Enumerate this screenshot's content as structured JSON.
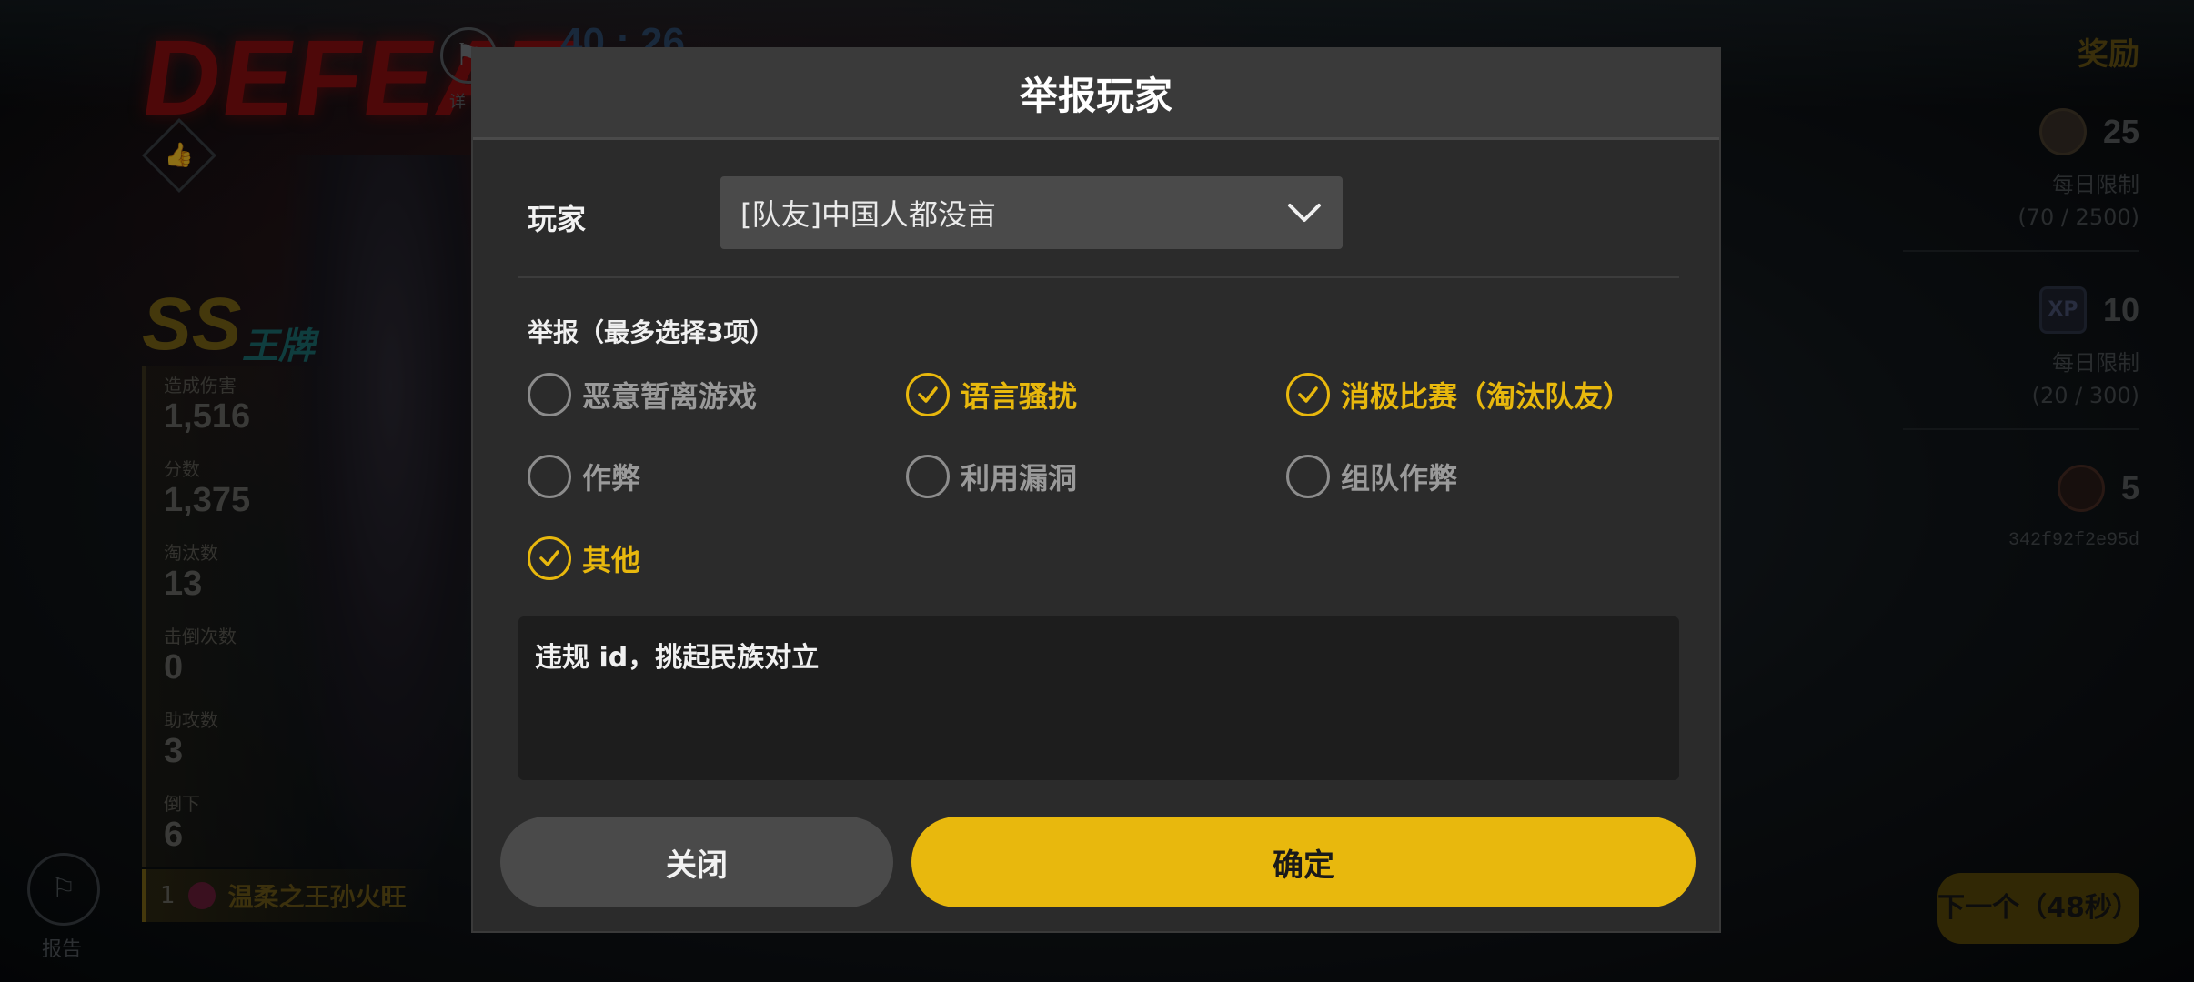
{
  "background": {
    "result_banner": "DEFEAT",
    "detail_label": "详",
    "score_peek": "40 : 26",
    "rank": "SS",
    "ace_label": "王牌",
    "stats": [
      {
        "label": "造成伤害",
        "value": "1,516"
      },
      {
        "label": "分数",
        "value": "1,375"
      },
      {
        "label": "淘汰数",
        "value": "13"
      },
      {
        "label": "击倒次数",
        "value": "0"
      },
      {
        "label": "助攻数",
        "value": "3"
      },
      {
        "label": "倒下",
        "value": "6"
      }
    ],
    "player_strip": {
      "index": "1",
      "name": "温柔之王孙火旺"
    },
    "report_label": "报告",
    "rewards": {
      "title": "奖励",
      "items": [
        {
          "icon": "coin-icon",
          "amount": "25",
          "limit_label": "每日限制",
          "limit_value": "(70 / 2500)"
        },
        {
          "icon": "xp-icon",
          "amount": "10",
          "limit_label": "每日限制",
          "limit_value": "(20 / 300)"
        },
        {
          "icon": "shield-badge-icon",
          "amount": "5",
          "hash": "342f92f2e95d"
        }
      ]
    },
    "next_button": "下一个（48秒）"
  },
  "dialog": {
    "title": "举报玩家",
    "player_label": "玩家",
    "player_selected": "[队友]中国人都没亩",
    "reason_title": "举报（最多选择3项）",
    "options": [
      {
        "label": "恶意暂离游戏",
        "checked": false
      },
      {
        "label": "语言骚扰",
        "checked": true
      },
      {
        "label": "消极比赛（淘汰队友）",
        "checked": true
      },
      {
        "label": "作弊",
        "checked": false
      },
      {
        "label": "利用漏洞",
        "checked": false
      },
      {
        "label": "组队作弊",
        "checked": false
      },
      {
        "label": "其他",
        "checked": true
      }
    ],
    "note_text": "违规 id，挑起民族对立",
    "close_label": "关闭",
    "confirm_label": "确定"
  },
  "colors": {
    "accent": "#e8b80d",
    "dialog_bg": "#2b2b2b",
    "header_bg": "#3a3a3a"
  }
}
